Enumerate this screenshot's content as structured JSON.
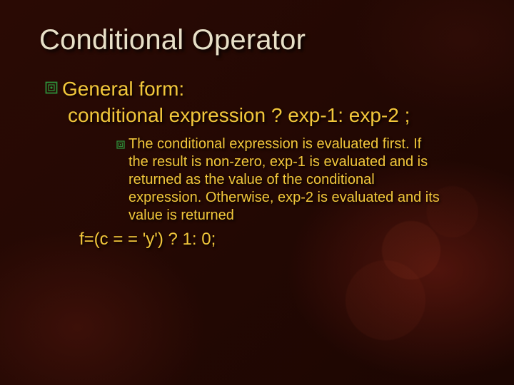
{
  "slide": {
    "title": "Conditional Operator",
    "bullet1": {
      "label": "General form:",
      "syntax": "conditional expression ? exp-1: exp-2 ;"
    },
    "bullet2": {
      "text": "The conditional expression is evaluated first. If the result is non-zero, exp-1 is evaluated and is returned as the value of the conditional expression. Otherwise, exp-2 is evaluated and its value is returned"
    },
    "example": "f=(c = = 'y') ? 1: 0;"
  }
}
